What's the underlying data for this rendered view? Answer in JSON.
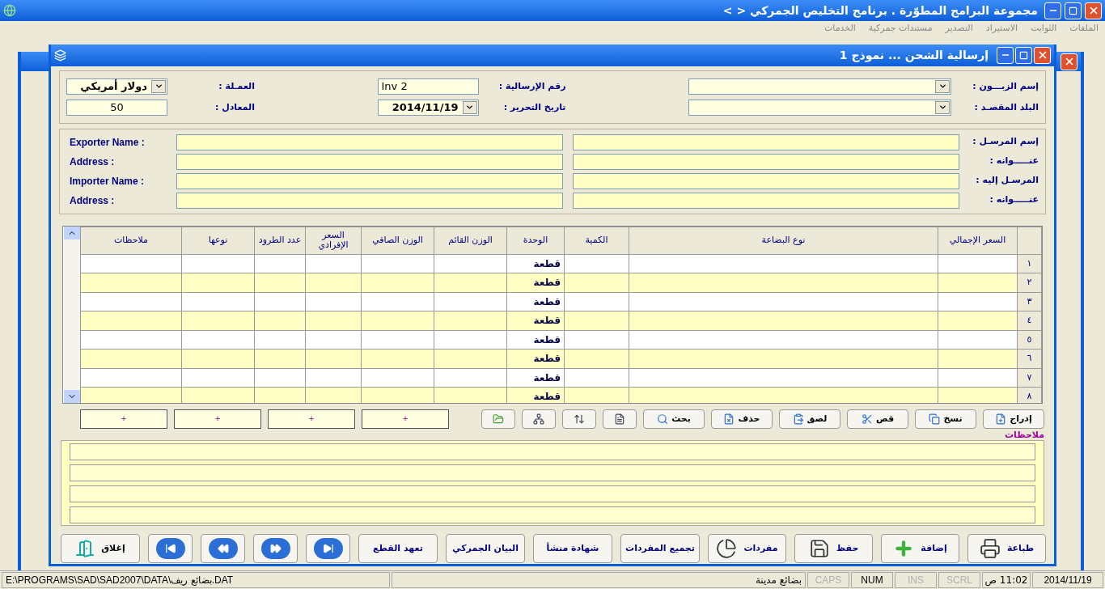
{
  "app": {
    "title": "مجموعة البرامج المطوّرة . برنامج التخليص الجمركي <  >",
    "menu": [
      "الملفات",
      "الثوابت",
      "الاستيراد",
      "التصدير",
      "مستندات جمركية",
      "الخدمات"
    ]
  },
  "dialog": {
    "title": "إرسالية الشحن ... نموذج 1"
  },
  "header_fields": [
    {
      "label": "إسم الزبـــون :",
      "kind": "combo"
    },
    {
      "label": "رقم الإرسالية :",
      "value": "Inv 2",
      "kind": "text"
    },
    {
      "label": "العمـلة :",
      "value": "دولار أمريكي",
      "kind": "combo"
    },
    {
      "label": "البلد المقصـد :",
      "kind": "combo"
    },
    {
      "label": "تاريخ التحرير :",
      "value": "2014/11/19",
      "kind": "combo"
    },
    {
      "label": "المعادل :",
      "value": "50",
      "kind": "number"
    }
  ],
  "party_fields": [
    {
      "label_ar": "إسم المرسـل :",
      "label_en": "Exporter Name :"
    },
    {
      "label_ar": "عنـــــوانه :",
      "label_en": "Address :"
    },
    {
      "label_ar": "المرسـل إليه :",
      "label_en": "Importer Name :"
    },
    {
      "label_ar": "عنـــــوانه :",
      "label_en": "Address :"
    }
  ],
  "table": {
    "columns": [
      "السعر الإجمالي",
      "نوع البضاعة",
      "الكمية",
      "الوحدة",
      "الوزن القائم",
      "الوزن الصافي",
      "السعر الإفرادي",
      "عدد الطرود",
      "نوعها",
      "ملاحظات"
    ],
    "rows": [
      {
        "number": "١",
        "unit": "قطعة"
      },
      {
        "number": "٢",
        "unit": "قطعة"
      },
      {
        "number": "٣",
        "unit": "قطعة"
      },
      {
        "number": "٤",
        "unit": "قطعة"
      },
      {
        "number": "٥",
        "unit": "قطعة"
      },
      {
        "number": "٦",
        "unit": "قطعة"
      },
      {
        "number": "٧",
        "unit": "قطعة"
      },
      {
        "number": "٨",
        "unit": "قطعة"
      }
    ]
  },
  "edit_buttons": [
    "إدراج",
    "نسخ",
    "قص",
    "لصق",
    "حذف",
    "بحث"
  ],
  "totals": [
    "+",
    "+",
    "+",
    "+"
  ],
  "notes": {
    "label": "ملاحظات"
  },
  "action_buttons": [
    "طباعة",
    "إضافة",
    "حفظ",
    "مفردات",
    "تجميع المفردات",
    "شهادة منشأ",
    "البيان الجمركي",
    "تعهد القطع"
  ],
  "close_button": "إغلاق",
  "status_bar": {
    "date": "2014/11/19",
    "time": "11:02 ص",
    "indicators": [
      {
        "label": "SCRL",
        "on": false
      },
      {
        "label": "INS",
        "on": false
      },
      {
        "label": "NUM",
        "on": true
      },
      {
        "label": "CAPS",
        "on": false
      }
    ],
    "company": "بضائع مدينة",
    "path": "E:\\PROGRAMS\\SAD\\SAD2007\\DATA\\بضائع ريف.DAT"
  }
}
